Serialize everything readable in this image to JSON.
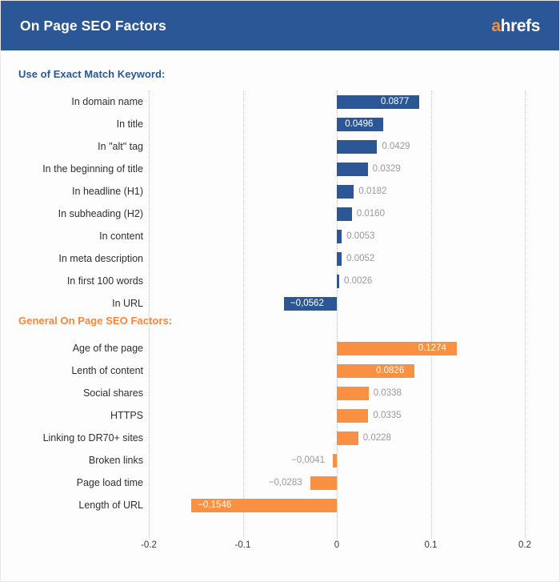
{
  "header": {
    "title": "On Page SEO Factors",
    "logo_a": "a",
    "logo_rest": "hrefs",
    "bg_color": "#2b5797",
    "logo_accent": "#f79038"
  },
  "chart_data": {
    "type": "bar",
    "orientation": "horizontal",
    "title": "On Page SEO Factors",
    "xlabel": "",
    "ylabel": "",
    "xlim": [
      -0.2,
      0.2
    ],
    "xticks": [
      -0.2,
      -0.1,
      0,
      0.1,
      0.2
    ],
    "xtick_labels": [
      "-0.2",
      "-0.1",
      "0",
      "0.1",
      "0.2"
    ],
    "grid": true,
    "legend": "none",
    "groups": [
      {
        "name": "Use of Exact Match Keyword:",
        "color": "#2b5797",
        "categories": [
          "In domain name",
          "In title",
          "In \"alt\" tag",
          "In the beginning of title",
          "In headline (H1)",
          "In subheading (H2)",
          "In content",
          "In meta description",
          "In first 100 words",
          "In URL"
        ],
        "values": [
          0.0877,
          0.0496,
          0.0429,
          0.0329,
          0.0182,
          0.016,
          0.0053,
          0.0052,
          0.0026,
          -0.0562
        ],
        "labels": [
          "0.0877",
          "0.0496",
          "0.0429",
          "0.0329",
          "0.0182",
          "0.0160",
          "0.0053",
          "0.0052",
          "0.0026",
          "−0,0562"
        ]
      },
      {
        "name": "General On Page SEO Factors:",
        "color": "#fa9142",
        "categories": [
          "Age of the page",
          "Lenth of content",
          "Social shares",
          "HTTPS",
          "Linking to DR70+ sites",
          "Broken links",
          "Page load time",
          "Length of URL"
        ],
        "values": [
          0.1274,
          0.0826,
          0.0338,
          0.0335,
          0.0228,
          -0.0041,
          -0.0283,
          -0.1546
        ],
        "labels": [
          "0.1274",
          "0.0826",
          "0.0338",
          "0.0335",
          "0.0228",
          "−0,0041",
          "−0,0283",
          "−0,1546"
        ]
      }
    ]
  }
}
